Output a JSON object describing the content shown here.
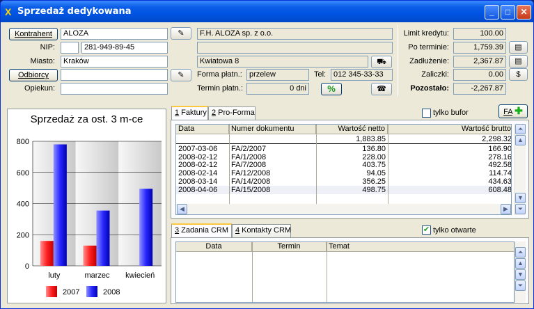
{
  "window": {
    "title": "Sprzedaż dedykowana",
    "title_icon": "X",
    "min": "_",
    "max": "□",
    "close": "✕"
  },
  "form": {
    "kontrahent_btn": "Kontrahent",
    "kontrahent_value": "ALOZA",
    "full_name": "F.H. ALOZA sp. z o.o.",
    "nip_label": "NIP:",
    "nip_prefix": "",
    "nip_value": "281-949-89-45",
    "name2": "",
    "miasto_label": "Miasto:",
    "miasto_value": "Kraków",
    "street": "Kwiatowa 8",
    "odbiorcy_btn": "Odbiorcy",
    "odbiorcy_value": "",
    "forma_label": "Forma płatn.:",
    "forma_value": "przelew",
    "tel_label": "Tel:",
    "tel_value": "012 345-33-33",
    "opiekun_label": "Opiekun:",
    "opiekun_value": "",
    "termin_label": "Termin płatn.:",
    "termin_value": "0 dni"
  },
  "credit": {
    "limit_label": "Limit kredytu:",
    "limit_value": "100.00",
    "po_label": "Po terminie:",
    "po_value": "1,759.39",
    "zad_label": "Zadłużenie:",
    "zad_value": "2,367.87",
    "zal_label": "Zaliczki:",
    "zal_value": "0.00",
    "poz_label": "Pozostało:",
    "poz_value": "-2,267.87"
  },
  "chart_data": {
    "type": "bar",
    "title": "Sprzedaż za ost. 3 m-ce",
    "categories": [
      "luty",
      "marzec",
      "kwiecień"
    ],
    "series": [
      {
        "name": "2007",
        "values": [
          160,
          130,
          0
        ],
        "color": "#ff2020"
      },
      {
        "name": "2008",
        "values": [
          780,
          355,
          495
        ],
        "color": "#2828ff"
      }
    ],
    "ylim": [
      0,
      800
    ],
    "yticks": [
      "0",
      "200",
      "400",
      "600",
      "800"
    ]
  },
  "tabs_top": {
    "t1_num": "1",
    "t1": " Faktury",
    "t2_num": "2",
    "t2": " Pro-Forma",
    "bufor_label": "tylko bufor",
    "fa_btn": "FA"
  },
  "invoices": {
    "headers": [
      "Data",
      "Numer dokumentu",
      "Wartość netto",
      "Wartość brutto"
    ],
    "total_netto": "1,883.85",
    "total_brutto": "2,298.32",
    "rows": [
      [
        "2007-03-06",
        "FA/2/2007",
        "136.80",
        "166.90"
      ],
      [
        "2008-02-12",
        "FA/1/2008",
        "228.00",
        "278.16"
      ],
      [
        "2008-02-12",
        "FA/7/2008",
        "403.75",
        "492.58"
      ],
      [
        "2008-02-14",
        "FA/12/2008",
        "94.05",
        "114.74"
      ],
      [
        "2008-03-14",
        "FA/14/2008",
        "356.25",
        "434.63"
      ],
      [
        "2008-04-06",
        "FA/15/2008",
        "498.75",
        "608.48"
      ]
    ]
  },
  "tabs_bottom": {
    "t3_num": "3",
    "t3": " Zadania CRM",
    "t4_num": "4",
    "t4": " Kontakty CRM",
    "open_label": "tylko otwarte"
  },
  "crm": {
    "headers": [
      "Data",
      "Termin",
      "Temat"
    ]
  }
}
